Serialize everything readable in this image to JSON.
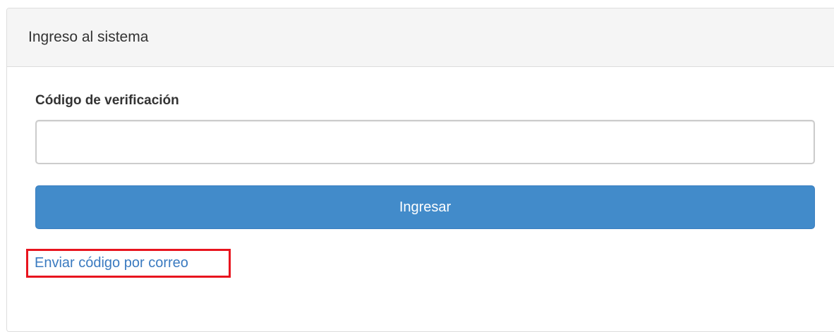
{
  "panel": {
    "title": "Ingreso al sistema"
  },
  "form": {
    "verification_label": "Código de verificación",
    "verification_value": "",
    "submit_label": "Ingresar",
    "email_link_label": "Enviar código por correo"
  },
  "colors": {
    "primary_button": "#428bca",
    "link": "#3a7ac0",
    "highlight_border": "#e8141e"
  }
}
